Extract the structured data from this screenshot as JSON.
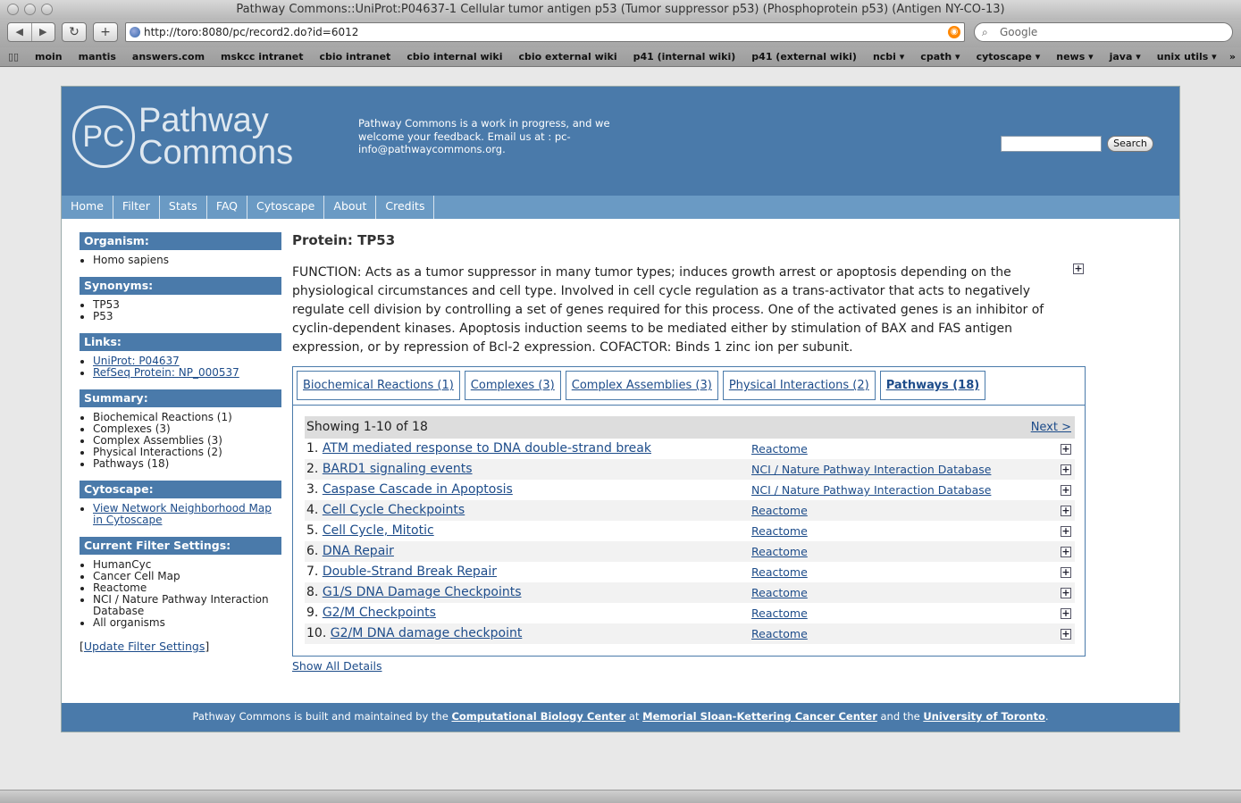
{
  "window": {
    "title": "Pathway Commons::UniProt:P04637-1 Cellular tumor antigen p53 (Tumor suppressor p53) (Phosphoprotein p53) (Antigen NY-CO-13)"
  },
  "browser": {
    "back_icon": "◀",
    "forward_icon": "▶",
    "reload_icon": "reload-icon",
    "add_icon": "add-icon",
    "url": "http://toro:8080/pc/record2.do?id=6012",
    "search_placeholder": "Google",
    "bookmarks": [
      "moin",
      "mantis",
      "answers.com",
      "mskcc intranet",
      "cbio intranet",
      "cbio internal wiki",
      "cbio external wiki",
      "p41 (internal wiki)",
      "p41 (external wiki)",
      "ncbi ▾",
      "cpath ▾",
      "cytoscape ▾",
      "news ▾",
      "java ▾",
      "unix utils ▾"
    ]
  },
  "header": {
    "logo_mark": "PC",
    "logo_line1": "Pathway",
    "logo_line2": "Commons",
    "tagline": "Pathway Commons is a work in progress, and we welcome your feedback.   Email us at : pc-info@pathwaycommons.org.",
    "search_button": "Search"
  },
  "nav": [
    "Home",
    "Filter",
    "Stats",
    "FAQ",
    "Cytoscape",
    "About",
    "Credits"
  ],
  "sidebar": {
    "organism": {
      "title": "Organism:",
      "items": [
        "Homo sapiens"
      ]
    },
    "synonyms": {
      "title": "Synonyms:",
      "items": [
        "TP53",
        "P53"
      ]
    },
    "links": {
      "title": "Links:",
      "items": [
        "UniProt: P04637",
        "RefSeq Protein: NP_000537"
      ]
    },
    "summary": {
      "title": "Summary:",
      "items": [
        "Biochemical Reactions (1)",
        "Complexes (3)",
        "Complex Assemblies (3)",
        "Physical Interactions (2)",
        "Pathways (18)"
      ]
    },
    "cytoscape": {
      "title": "Cytoscape:",
      "link": "View Network Neighborhood Map in Cytoscape"
    },
    "filters": {
      "title": "Current Filter Settings:",
      "items": [
        "HumanCyc",
        "Cancer Cell Map",
        "Reactome",
        "NCI / Nature Pathway Interaction Database",
        "All organisms"
      ]
    },
    "update_open": "[",
    "update_link": "Update Filter Settings",
    "update_close": "]"
  },
  "main": {
    "title": "Protein: TP53",
    "function": "FUNCTION: Acts as a tumor suppressor in many tumor types; induces growth arrest or apoptosis depending on the physiological circumstances and cell type. Involved in cell cycle regulation as a trans-activator that acts to negatively regulate cell division by controlling a set of genes required for this process. One of the activated genes is an inhibitor of cyclin-dependent kinases. Apoptosis induction seems to be mediated either by stimulation of BAX and FAS antigen expression, or by repression of Bcl-2 expression. COFACTOR: Binds 1 zinc ion per subunit.",
    "tabs": [
      "Biochemical Reactions (1)",
      "Complexes (3)",
      "Complex Assemblies (3)",
      "Physical Interactions (2)",
      "Pathways (18)"
    ],
    "active_tab": 4,
    "showing": "Showing 1-10 of 18",
    "next": "Next >",
    "rows": [
      {
        "num": "1.",
        "name": "ATM mediated response to DNA double-strand break",
        "source": "Reactome"
      },
      {
        "num": "2.",
        "name": "BARD1 signaling events",
        "source": "NCI / Nature Pathway Interaction Database"
      },
      {
        "num": "3.",
        "name": "Caspase Cascade in Apoptosis",
        "source": "NCI / Nature Pathway Interaction Database"
      },
      {
        "num": "4.",
        "name": "Cell Cycle Checkpoints",
        "source": "Reactome"
      },
      {
        "num": "5.",
        "name": "Cell Cycle, Mitotic",
        "source": "Reactome"
      },
      {
        "num": "6.",
        "name": "DNA Repair",
        "source": "Reactome"
      },
      {
        "num": "7.",
        "name": "Double-Strand Break Repair",
        "source": "Reactome"
      },
      {
        "num": "8.",
        "name": "G1/S DNA Damage Checkpoints",
        "source": "Reactome"
      },
      {
        "num": "9.",
        "name": "G2/M Checkpoints",
        "source": "Reactome"
      },
      {
        "num": "10.",
        "name": "G2/M DNA damage checkpoint",
        "source": "Reactome"
      }
    ],
    "show_all": "Show All Details"
  },
  "footer": {
    "text1": "Pathway Commons is built and maintained by the ",
    "link1": "Computational Biology Center",
    "text2": " at ",
    "link2": "Memorial Sloan-Kettering Cancer Center",
    "text3": " and the ",
    "link3": "University of Toronto",
    "text4": "."
  },
  "colors": {
    "brand": "#4a7aaa",
    "nav": "#6a9ac4",
    "link": "#1d4c8a"
  }
}
